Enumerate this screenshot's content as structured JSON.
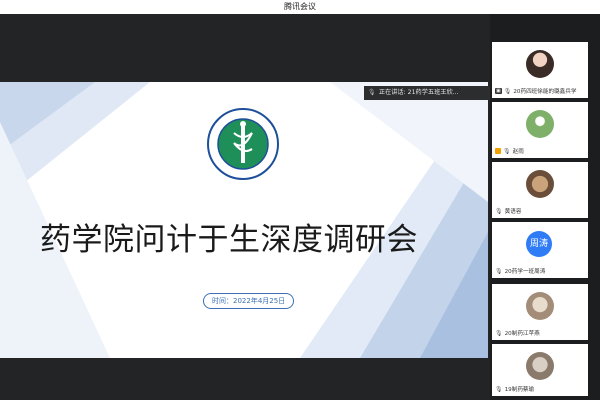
{
  "window": {
    "title": "腾讯会议"
  },
  "speaking": {
    "label": "正在讲话: 21药学五班王欣..."
  },
  "slide": {
    "title": "药学院问计于生深度调研会",
    "date_text": "时间：2022年4月25日"
  },
  "participants": [
    {
      "name": "20药四班徐能的璐鑫兵学"
    },
    {
      "name": "赵雨"
    },
    {
      "name": "黄语容"
    },
    {
      "name": "20药学一班周涛",
      "avatar_text": "周涛"
    },
    {
      "name": "20制药江苹燕"
    },
    {
      "name": "19制药蔡瑜"
    }
  ],
  "colors": {
    "accent": "#3b6fb6",
    "avatar_blue": "#2f7cf6",
    "slide_shape_light": "#dfe8f4",
    "slide_shape_mid": "#c2d3ea"
  }
}
